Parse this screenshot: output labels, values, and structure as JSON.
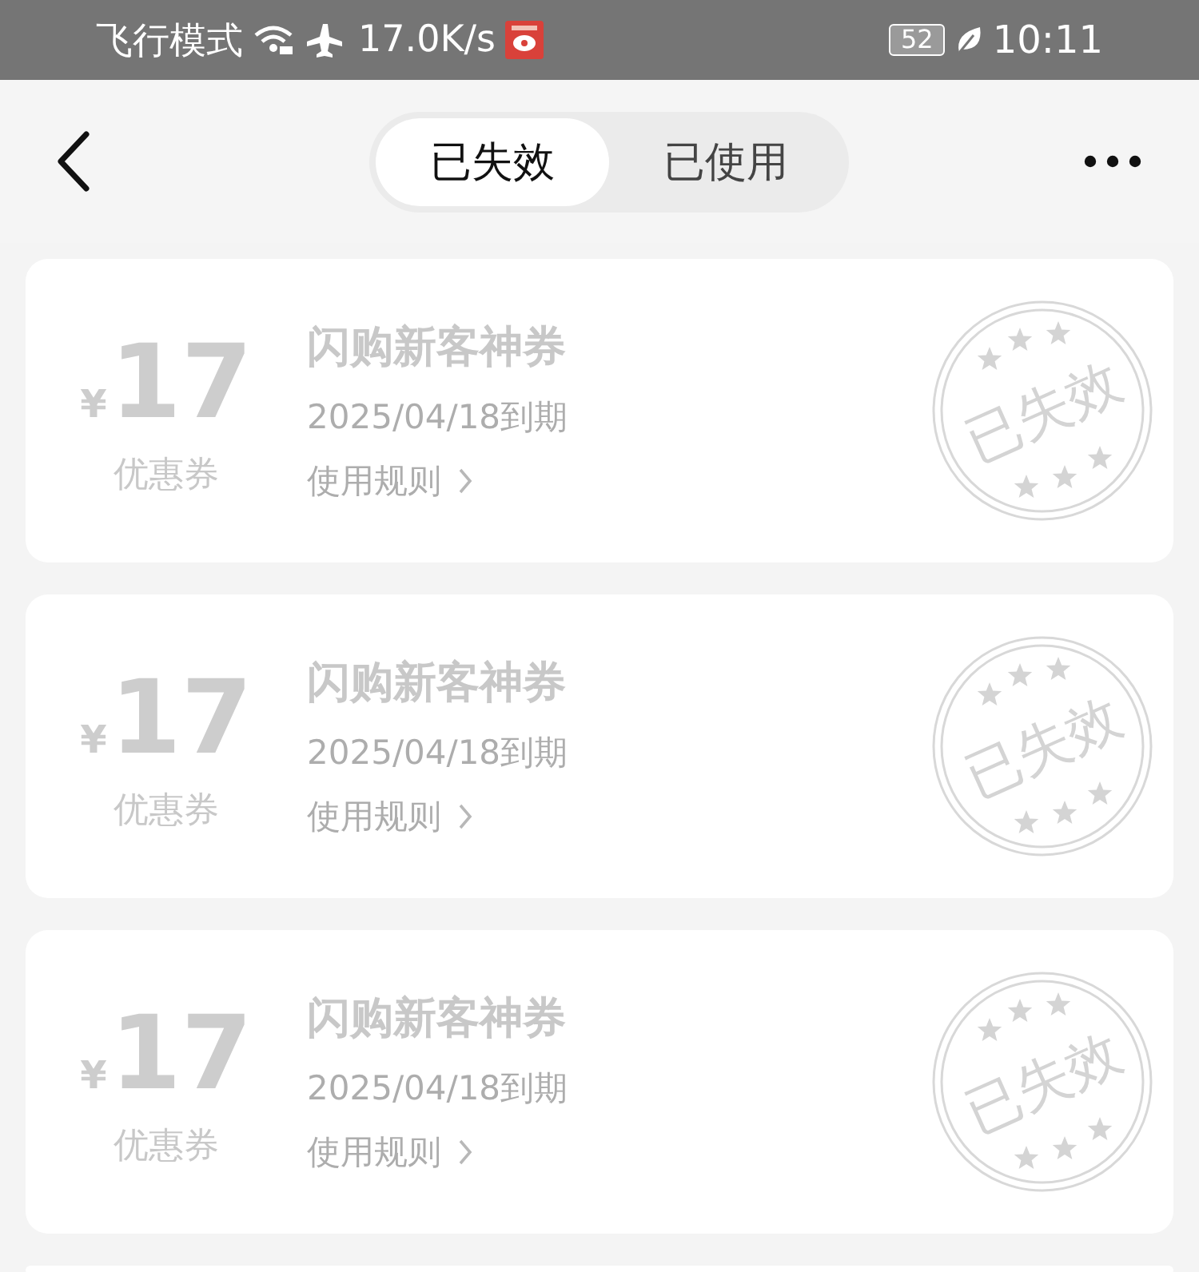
{
  "status_bar": {
    "mode": "飞行模式",
    "speed": "17.0K/s",
    "battery": "52",
    "time": "10:11"
  },
  "tabs": [
    {
      "label": "已失效",
      "selected": true
    },
    {
      "label": "已使用",
      "selected": false
    }
  ],
  "coupons": [
    {
      "currency": "¥",
      "amount": "17",
      "type": "优惠券",
      "title": "闪购新客神券",
      "expiry": "2025/04/18到期",
      "rules": "使用规则",
      "stamp": "已失效"
    },
    {
      "currency": "¥",
      "amount": "17",
      "type": "优惠券",
      "title": "闪购新客神券",
      "expiry": "2025/04/18到期",
      "rules": "使用规则",
      "stamp": "已失效"
    },
    {
      "currency": "¥",
      "amount": "17",
      "type": "优惠券",
      "title": "闪购新客神券",
      "expiry": "2025/04/18到期",
      "rules": "使用规则",
      "stamp": "已失效"
    }
  ]
}
